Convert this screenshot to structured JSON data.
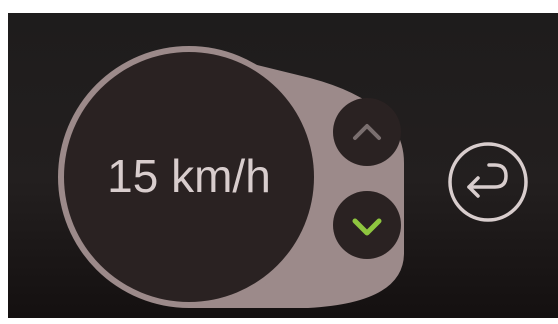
{
  "speed_control": {
    "speed_value": "15 km/h",
    "increase_icon": "chevron-up-icon",
    "decrease_icon": "chevron-down-icon"
  },
  "navigation": {
    "back_icon": "return-arrow-icon"
  },
  "colors": {
    "screen_background": "#221e1e",
    "dial_fill": "#2a2222",
    "panel_fill": "#9c8a8a",
    "text": "#d8cdcd",
    "accent_green": "#8ec63f",
    "icon_muted": "#7a6f6f"
  }
}
